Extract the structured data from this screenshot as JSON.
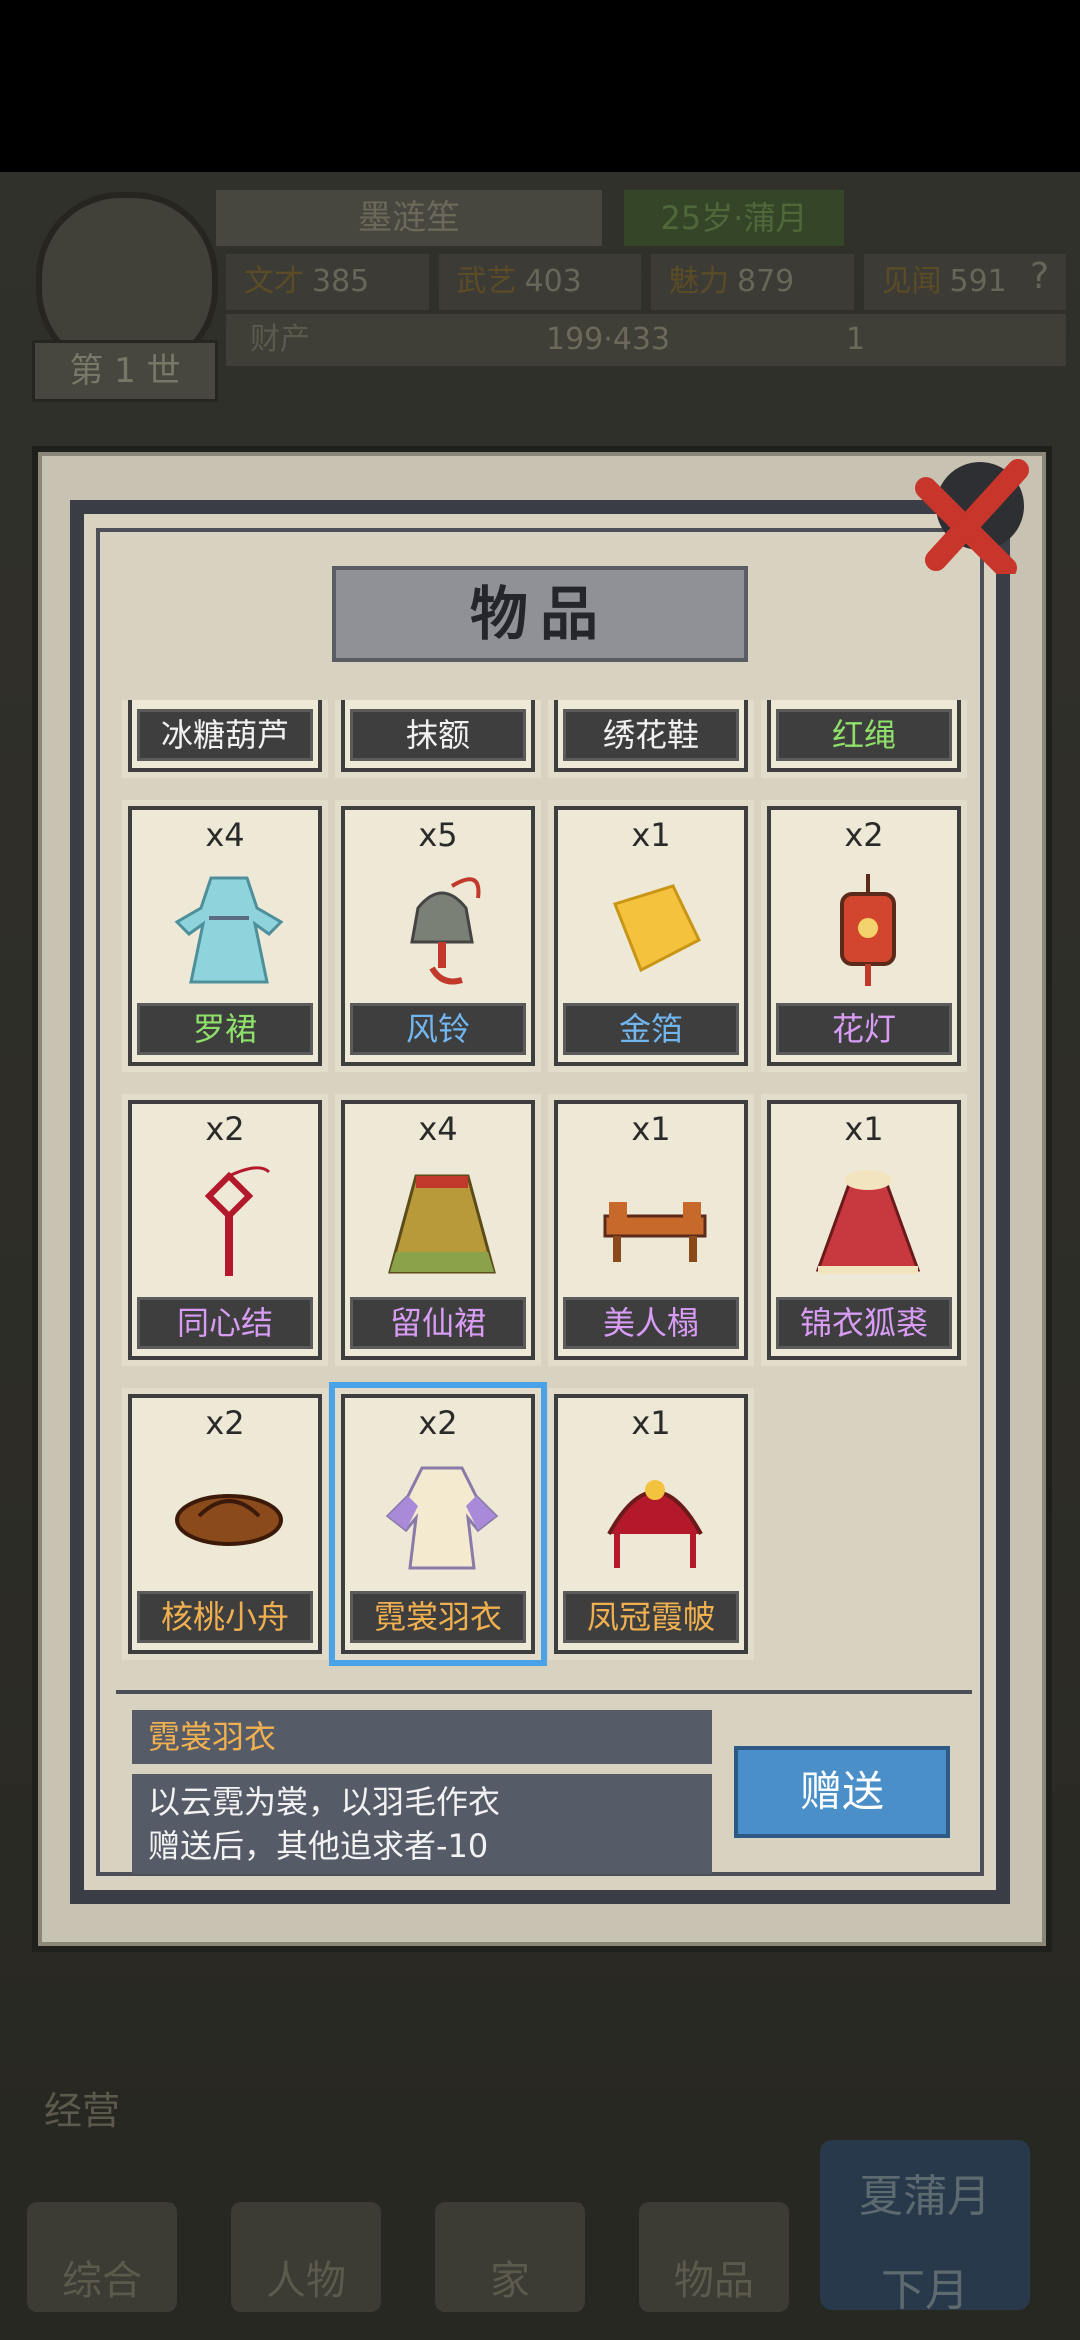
{
  "hud": {
    "name": "墨涟笙",
    "age_month": "25岁·蒲月",
    "generation": "第 1 世",
    "stats": [
      {
        "key": "文才",
        "value": "385"
      },
      {
        "key": "武艺",
        "value": "403"
      },
      {
        "key": "魅力",
        "value": "879"
      },
      {
        "key": "见闻",
        "value": "591"
      }
    ],
    "wealth_label": "财产",
    "wealth_value_1": "199",
    "wealth_value_2": "433",
    "wealth_value_3": "1",
    "help_icon": "?"
  },
  "modal": {
    "title": "物品",
    "close_icon": "close-x",
    "items": [
      {
        "qty": "",
        "name": "冰糖葫芦",
        "color": "white",
        "icon": "candied-hawthorn"
      },
      {
        "qty": "",
        "name": "抹额",
        "color": "white",
        "icon": "headband"
      },
      {
        "qty": "",
        "name": "绣花鞋",
        "color": "white",
        "icon": "embroidered-shoes"
      },
      {
        "qty": "",
        "name": "红绳",
        "color": "green",
        "icon": "red-string"
      },
      {
        "qty": "x4",
        "name": "罗裙",
        "color": "green",
        "icon": "dress"
      },
      {
        "qty": "x5",
        "name": "风铃",
        "color": "blue",
        "icon": "wind-chime"
      },
      {
        "qty": "x1",
        "name": "金箔",
        "color": "blue",
        "icon": "gold-leaf"
      },
      {
        "qty": "x2",
        "name": "花灯",
        "color": "purple",
        "icon": "lantern"
      },
      {
        "qty": "x2",
        "name": "同心结",
        "color": "purple",
        "icon": "chinese-knot"
      },
      {
        "qty": "x4",
        "name": "留仙裙",
        "color": "purple",
        "icon": "pleated-skirt"
      },
      {
        "qty": "x1",
        "name": "美人榻",
        "color": "purple",
        "icon": "daybed"
      },
      {
        "qty": "x1",
        "name": "锦衣狐裘",
        "color": "purple",
        "icon": "fur-cloak"
      },
      {
        "qty": "x2",
        "name": "核桃小舟",
        "color": "orange",
        "icon": "walnut-boat"
      },
      {
        "qty": "x2",
        "name": "霓裳羽衣",
        "color": "orange",
        "icon": "feather-robe",
        "selected": true
      },
      {
        "qty": "x1",
        "name": "凤冠霞帔",
        "color": "orange",
        "icon": "phoenix-crown"
      }
    ],
    "detail": {
      "name": "霓裳羽衣",
      "desc_line1": "以云霓为裳，以羽毛作衣",
      "desc_line2": "赠送后，其他追求者-10"
    },
    "give_button": "赠送"
  },
  "nav": {
    "manage": "经营",
    "items": [
      "综合",
      "人物",
      "家",
      "物品"
    ],
    "season": "夏",
    "month": "蒲月",
    "next_month": "下月"
  },
  "colors": {
    "white": "#f1f1f1",
    "green": "#8fe06b",
    "blue": "#72b6f0",
    "purple": "#d89cf4",
    "orange": "#f0b050",
    "selected_border": "#4aa3e8",
    "give_button_bg": "#4a8fc8"
  }
}
